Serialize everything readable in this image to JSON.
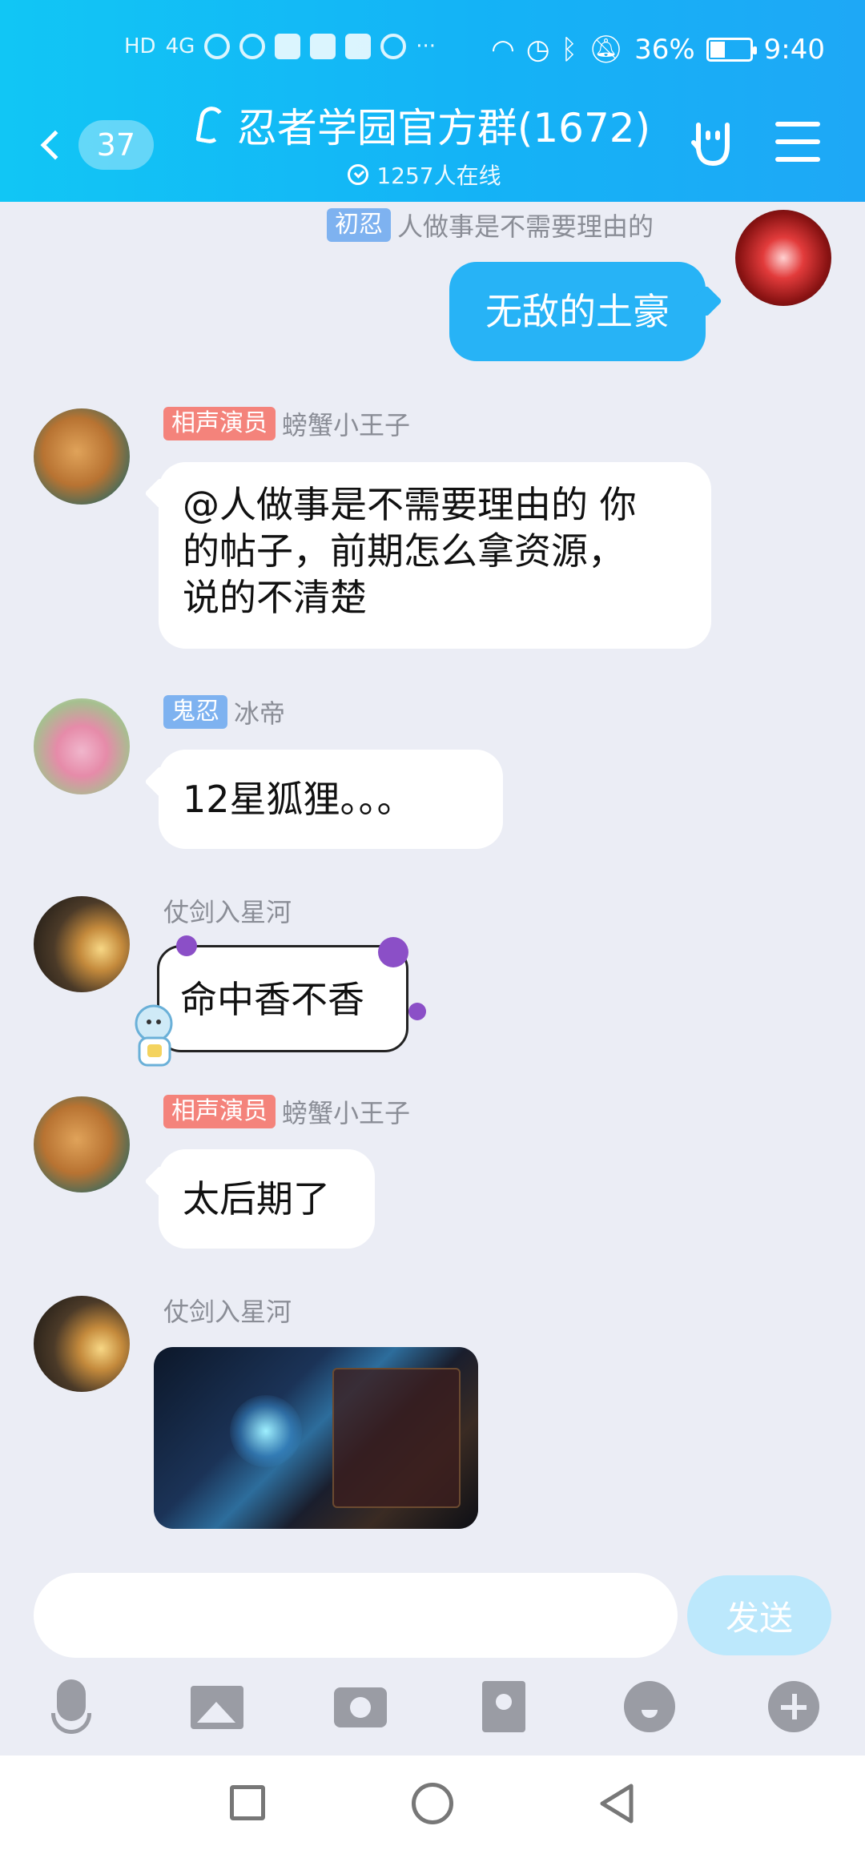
{
  "status_bar": {
    "left_text": "HD",
    "network": "4G",
    "more": "···",
    "battery": "36%",
    "battery_fraction": 0.36,
    "time": "9:40"
  },
  "header": {
    "unread_count": "37",
    "title": "忍者学园官方群(1672)",
    "online": "1257人在线"
  },
  "messages": [
    {
      "sender_tag": "初忍",
      "sender_name": "人做事是不需要理由的",
      "text": "无敌的土豪",
      "self": true
    },
    {
      "sender_tag": "相声演员",
      "sender_name": "螃蟹小王子",
      "text_lines": [
        "@人做事是不需要理由的 你",
        "的帖子，前期怎么拿资源，",
        "说的不清楚"
      ]
    },
    {
      "sender_tag": "鬼忍",
      "sender_name": "冰帝",
      "text": "12星狐狸。。。"
    },
    {
      "sender_tag": "",
      "sender_name": "仗剑入星河",
      "text": "命中香不香"
    },
    {
      "sender_tag": "相声演员",
      "sender_name": "螃蟹小王子",
      "text": "太后期了"
    },
    {
      "sender_tag": "",
      "sender_name": "仗剑入星河",
      "image": "game-screenshot"
    }
  ],
  "input": {
    "value": "",
    "placeholder": "",
    "send_label": "发送"
  },
  "toolbar_icons": [
    "mic-icon",
    "image-icon",
    "camera-icon",
    "red-packet-icon",
    "emoji-icon",
    "plus-icon"
  ],
  "colors": {
    "header": "#14b3f6",
    "self_bubble": "#27b3f6",
    "tag_red": "#f4837b",
    "tag_blue": "#7eb2f0",
    "send_disabled": "#bce8fc"
  }
}
